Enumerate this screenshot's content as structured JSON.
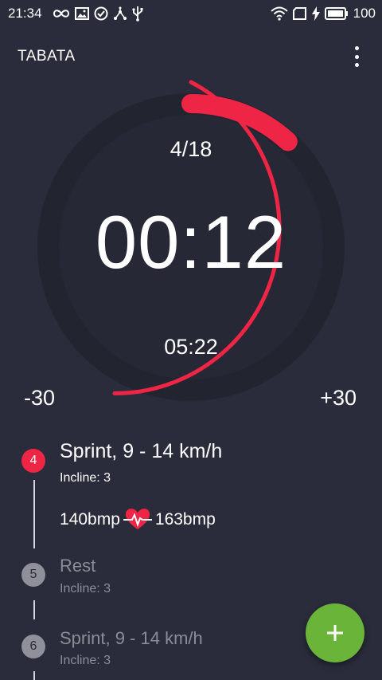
{
  "status_bar": {
    "time": "21:34",
    "battery": "100"
  },
  "app_bar": {
    "title": "TABATA"
  },
  "timer": {
    "round": "4/18",
    "time": "00:12",
    "total_remaining": "05:22",
    "minus_label": "-30",
    "plus_label": "+30",
    "accent_color": "#ef2546"
  },
  "steps": [
    {
      "number": "4",
      "title": "Sprint, 9 - 14 km/h",
      "incline": "Incline: 3",
      "bpm_low": "140bmp",
      "bpm_high": "163bmp",
      "active": true
    },
    {
      "number": "5",
      "title": "Rest",
      "incline": "Incline: 3",
      "active": false
    },
    {
      "number": "6",
      "title": "Sprint, 9 - 14 km/h",
      "incline": "Incline: 3",
      "active": false
    }
  ],
  "fab": {
    "icon": "plus-icon",
    "color": "#6ab43a"
  }
}
